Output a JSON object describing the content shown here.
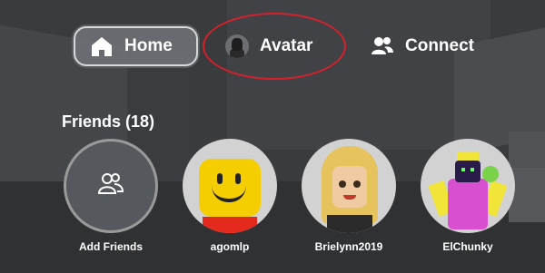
{
  "nav": {
    "tabs": [
      {
        "label": "Home",
        "icon": "home-icon",
        "selected": true
      },
      {
        "label": "Avatar",
        "icon": "avatar-thumbnail-icon",
        "selected": false
      },
      {
        "label": "Connect",
        "icon": "people-icon",
        "selected": false
      }
    ]
  },
  "highlight_color": "#d81f2a",
  "friends": {
    "title": "Friends (18)",
    "items": [
      {
        "name": "Add Friends",
        "icon": "add-friends-icon"
      },
      {
        "name": "agomlp"
      },
      {
        "name": "Brielynn2019"
      },
      {
        "name": "ElChunky"
      }
    ]
  }
}
